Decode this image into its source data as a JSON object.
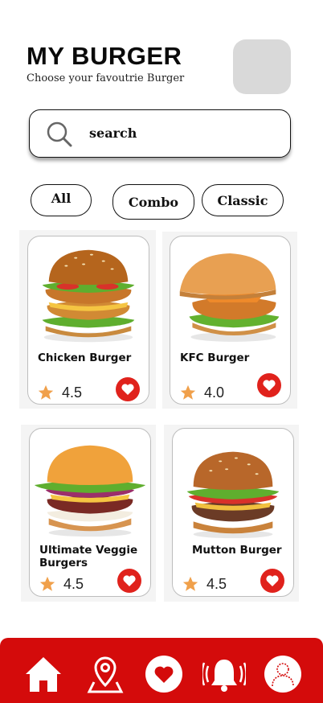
{
  "header": {
    "title": "MY BURGER",
    "subtitle": "Choose your favoutrie Burger"
  },
  "search": {
    "placeholder": "search"
  },
  "filters": [
    "All",
    "Combo",
    "Classic"
  ],
  "products": [
    {
      "name": "Chicken Burger",
      "rating": "4.5"
    },
    {
      "name": "KFC Burger",
      "rating": "4.0"
    },
    {
      "name": "Ultimate Veggie Burgers",
      "rating": "4.5"
    },
    {
      "name": "Mutton Burger",
      "rating": "4.5"
    }
  ],
  "colors": {
    "accent": "#d40b0b",
    "favorite": "#e0221c",
    "star": "#f0a04b"
  },
  "nav": {
    "items": [
      "home-icon",
      "map-pin-icon",
      "heart-icon",
      "bell-icon",
      "profile-icon"
    ]
  }
}
